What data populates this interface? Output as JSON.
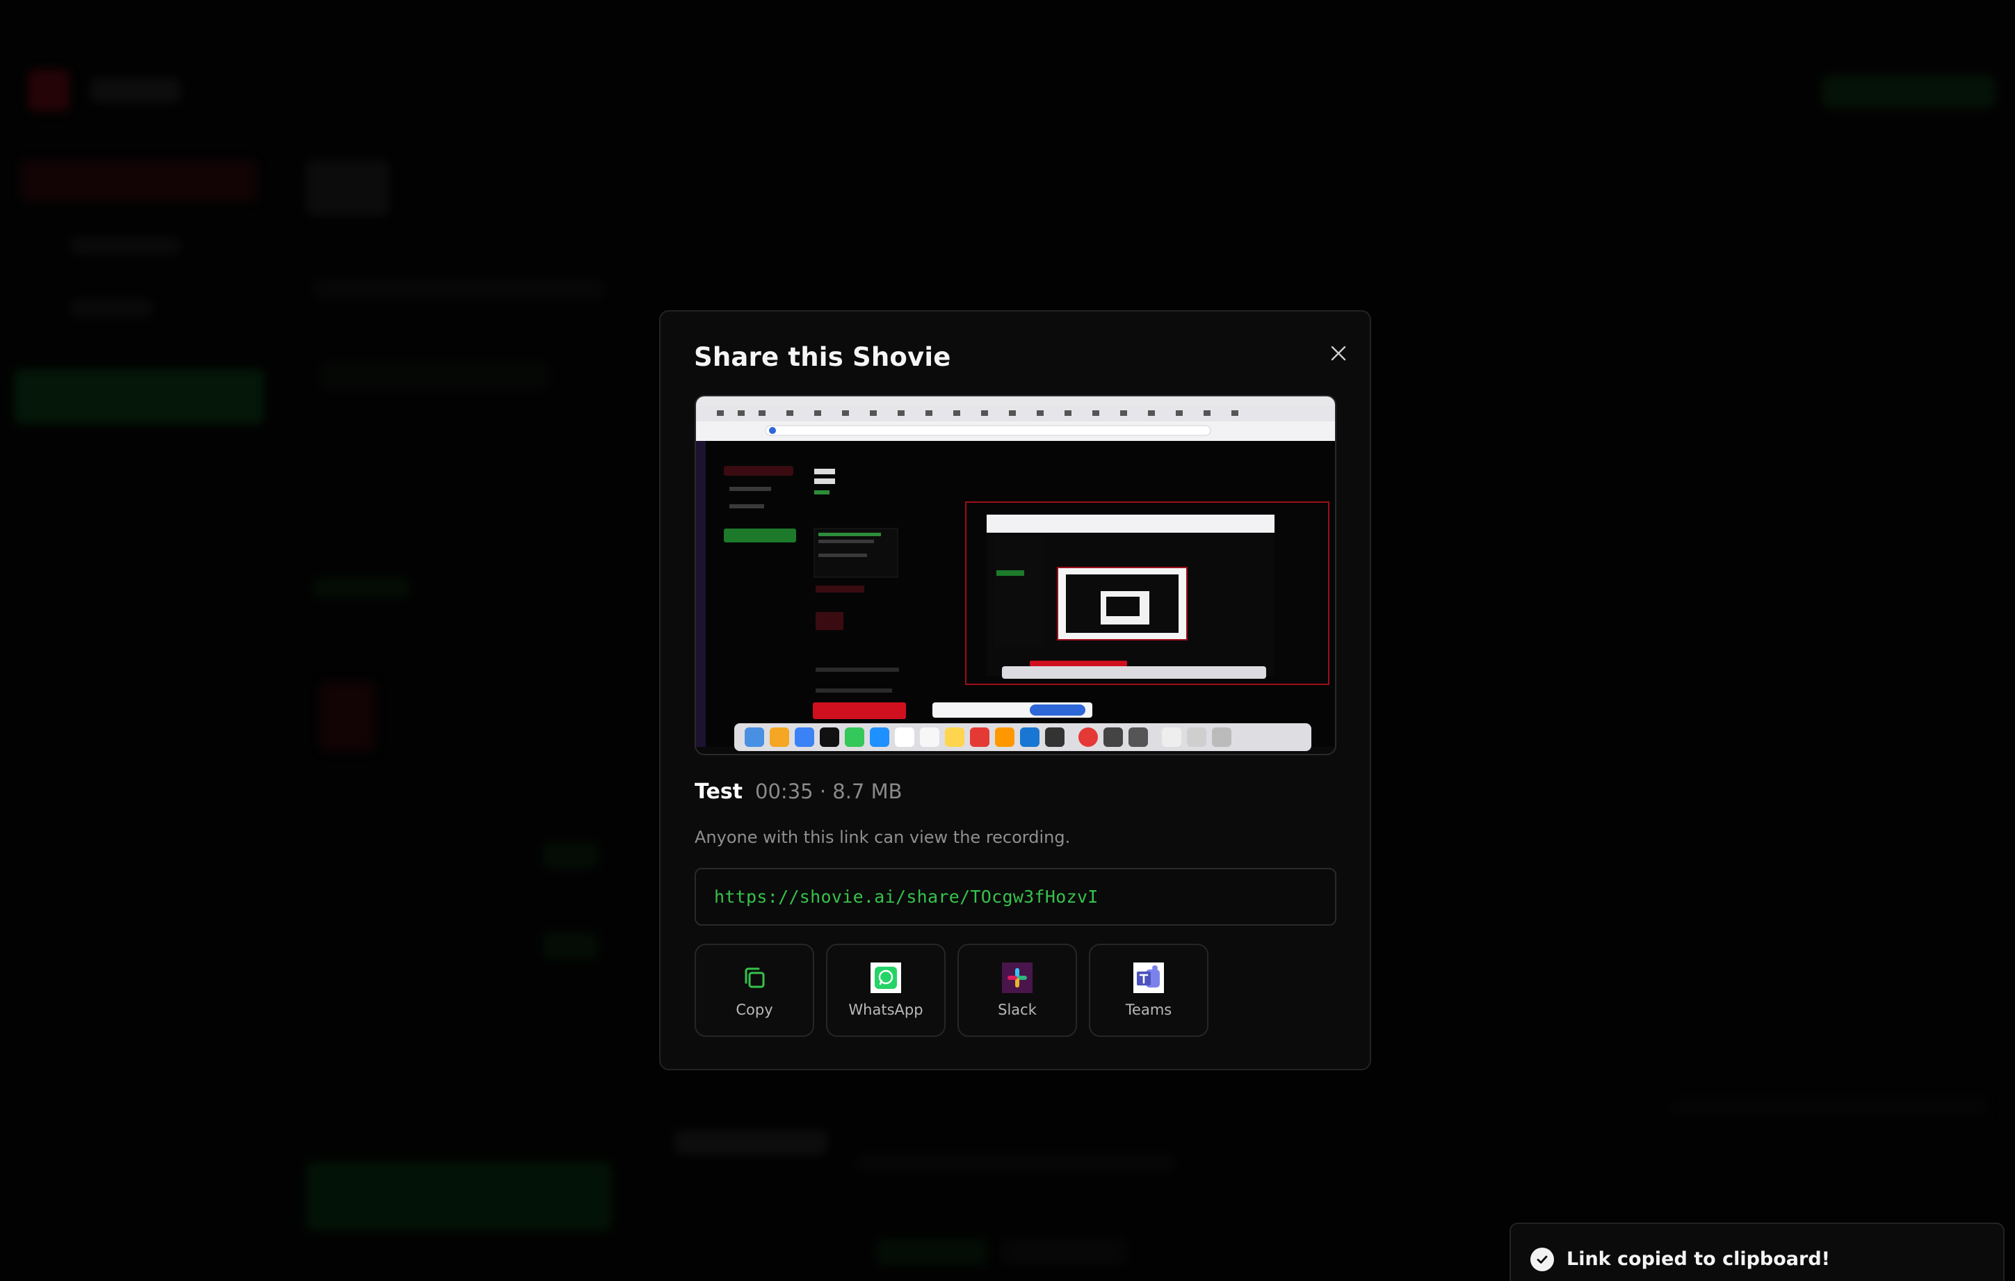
{
  "modal": {
    "title": "Share this Shovie",
    "close_icon": "close-icon"
  },
  "recording": {
    "name": "Test",
    "info": "00:35 · 8.7 MB"
  },
  "share": {
    "description": "Anyone with this link can view the recording.",
    "url": "https://shovie.ai/share/TOcgw3fHozvI"
  },
  "actions": [
    {
      "label": "Copy",
      "icon": "copy-icon"
    },
    {
      "label": "WhatsApp",
      "icon": "whatsapp-icon"
    },
    {
      "label": "Slack",
      "icon": "slack-icon"
    },
    {
      "label": "Teams",
      "icon": "teams-icon"
    }
  ],
  "toast": {
    "message": "Link copied to clipboard!",
    "icon": "check-circle-icon"
  },
  "colors": {
    "accent_green": "#36c24a",
    "danger_red": "#c8102e",
    "modal_bg": "#0b0b0b"
  }
}
